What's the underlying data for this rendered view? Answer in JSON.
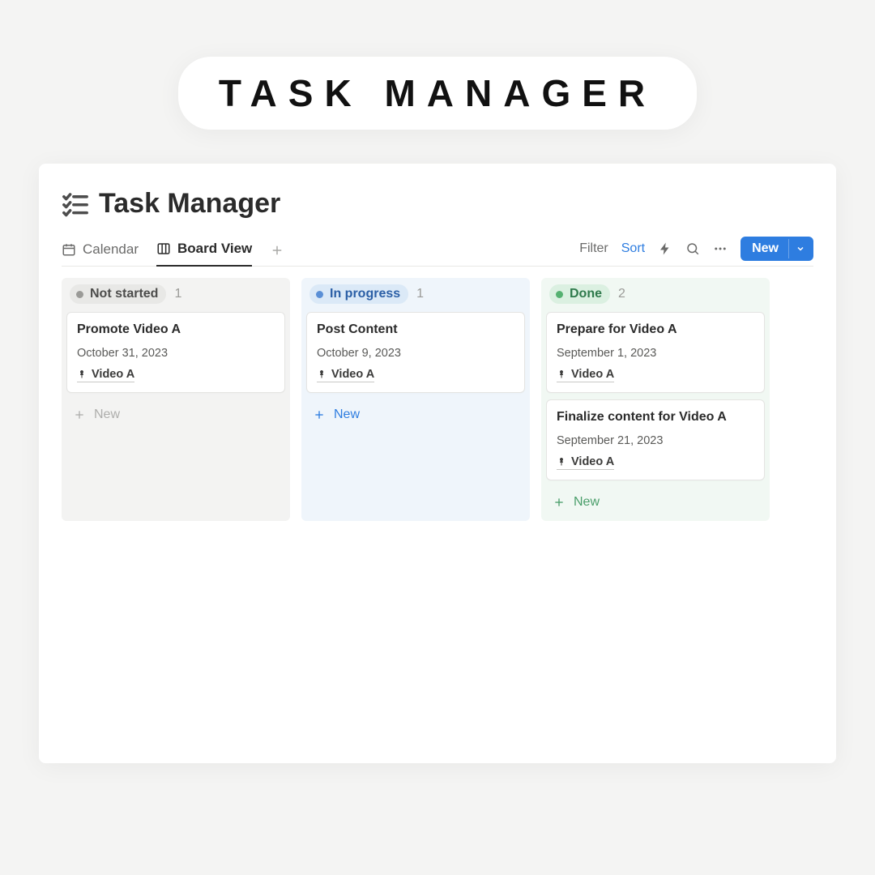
{
  "hero": {
    "title": "TASK MANAGER"
  },
  "page": {
    "title": "Task Manager"
  },
  "tabs": {
    "calendar": "Calendar",
    "board": "Board View"
  },
  "toolbar": {
    "filter": "Filter",
    "sort": "Sort",
    "new": "New"
  },
  "columns": [
    {
      "id": "not_started",
      "label": "Not started",
      "count": "1",
      "bg": "#f3f3f2",
      "pill_bg": "#e8e8e6",
      "pill_text": "#4d4d4c",
      "dot": "#9a9a97",
      "new_color": "gray",
      "cards": [
        {
          "title": "Promote Video A",
          "date": "October 31, 2023",
          "tag": "Video A"
        }
      ]
    },
    {
      "id": "in_progress",
      "label": "In progress",
      "count": "1",
      "bg": "#eff5fb",
      "pill_bg": "#dbe9f7",
      "pill_text": "#2b5fa6",
      "dot": "#5a8fd6",
      "new_color": "blue",
      "cards": [
        {
          "title": "Post Content",
          "date": "October 9, 2023",
          "tag": "Video A"
        }
      ]
    },
    {
      "id": "done",
      "label": "Done",
      "count": "2",
      "bg": "#f1f8f3",
      "pill_bg": "#dbf0e1",
      "pill_text": "#2f7a4c",
      "dot": "#55b171",
      "new_color": "green",
      "cards": [
        {
          "title": "Prepare for Video A",
          "date": "September 1, 2023",
          "tag": "Video A"
        },
        {
          "title": "Finalize content for Video A",
          "date": "September 21, 2023",
          "tag": "Video A"
        }
      ]
    }
  ],
  "new_label": "New"
}
